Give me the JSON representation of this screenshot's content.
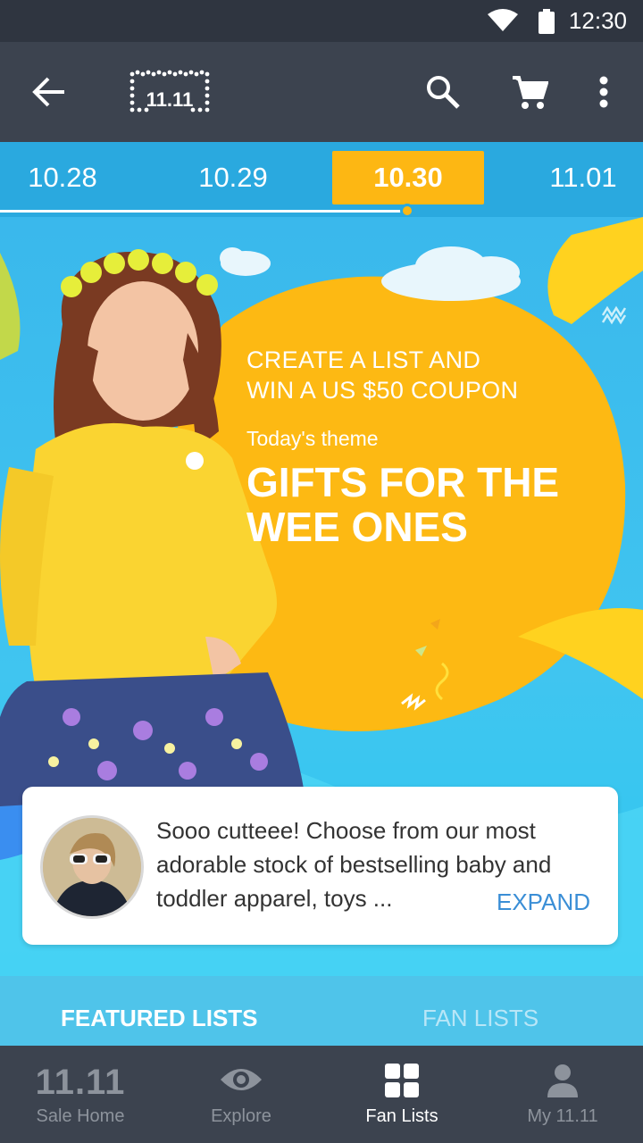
{
  "status_bar": {
    "time": "12:30",
    "icons": [
      "wifi-icon",
      "battery-icon"
    ]
  },
  "app_bar": {
    "logo_text": "11.11",
    "icons": [
      "back-arrow-icon",
      "search-icon",
      "cart-icon",
      "more-vert-icon"
    ]
  },
  "date_tabs": {
    "items": [
      {
        "label": "10.28"
      },
      {
        "label": "10.29"
      },
      {
        "label": "10.30"
      },
      {
        "label": "11.01"
      }
    ],
    "selected": "10.30"
  },
  "hero": {
    "cta_line1": "CREATE A LIST AND",
    "cta_line2": "WIN A US $50 COUPON",
    "theme_label": "Today's theme",
    "theme_line1": "GIFTS FOR THE",
    "theme_line2": "WEE ONES"
  },
  "card": {
    "description": "Sooo cutteee! Choose from our most adorable stock of bestselling baby and toddler apparel, toys ...",
    "expand_label": "EXPAND"
  },
  "section_tabs": {
    "featured": "FEATURED LISTS",
    "fan": "FAN LISTS"
  },
  "bottom_nav": {
    "items": [
      {
        "label": "Sale Home",
        "icon": "brand-1111-icon",
        "badge": "11.11"
      },
      {
        "label": "Explore",
        "icon": "eye-icon"
      },
      {
        "label": "Fan Lists",
        "icon": "grid-icon"
      },
      {
        "label": "My 11.11",
        "icon": "person-icon"
      }
    ],
    "active": "Fan Lists"
  },
  "colors": {
    "status_bar": "#2f3540",
    "app_bar": "#3c434f",
    "date_tabs": "#2aa9df",
    "accent_yellow": "#fdb713",
    "hero_blue": "#3ab8ec",
    "link_blue": "#3a8ed6"
  }
}
